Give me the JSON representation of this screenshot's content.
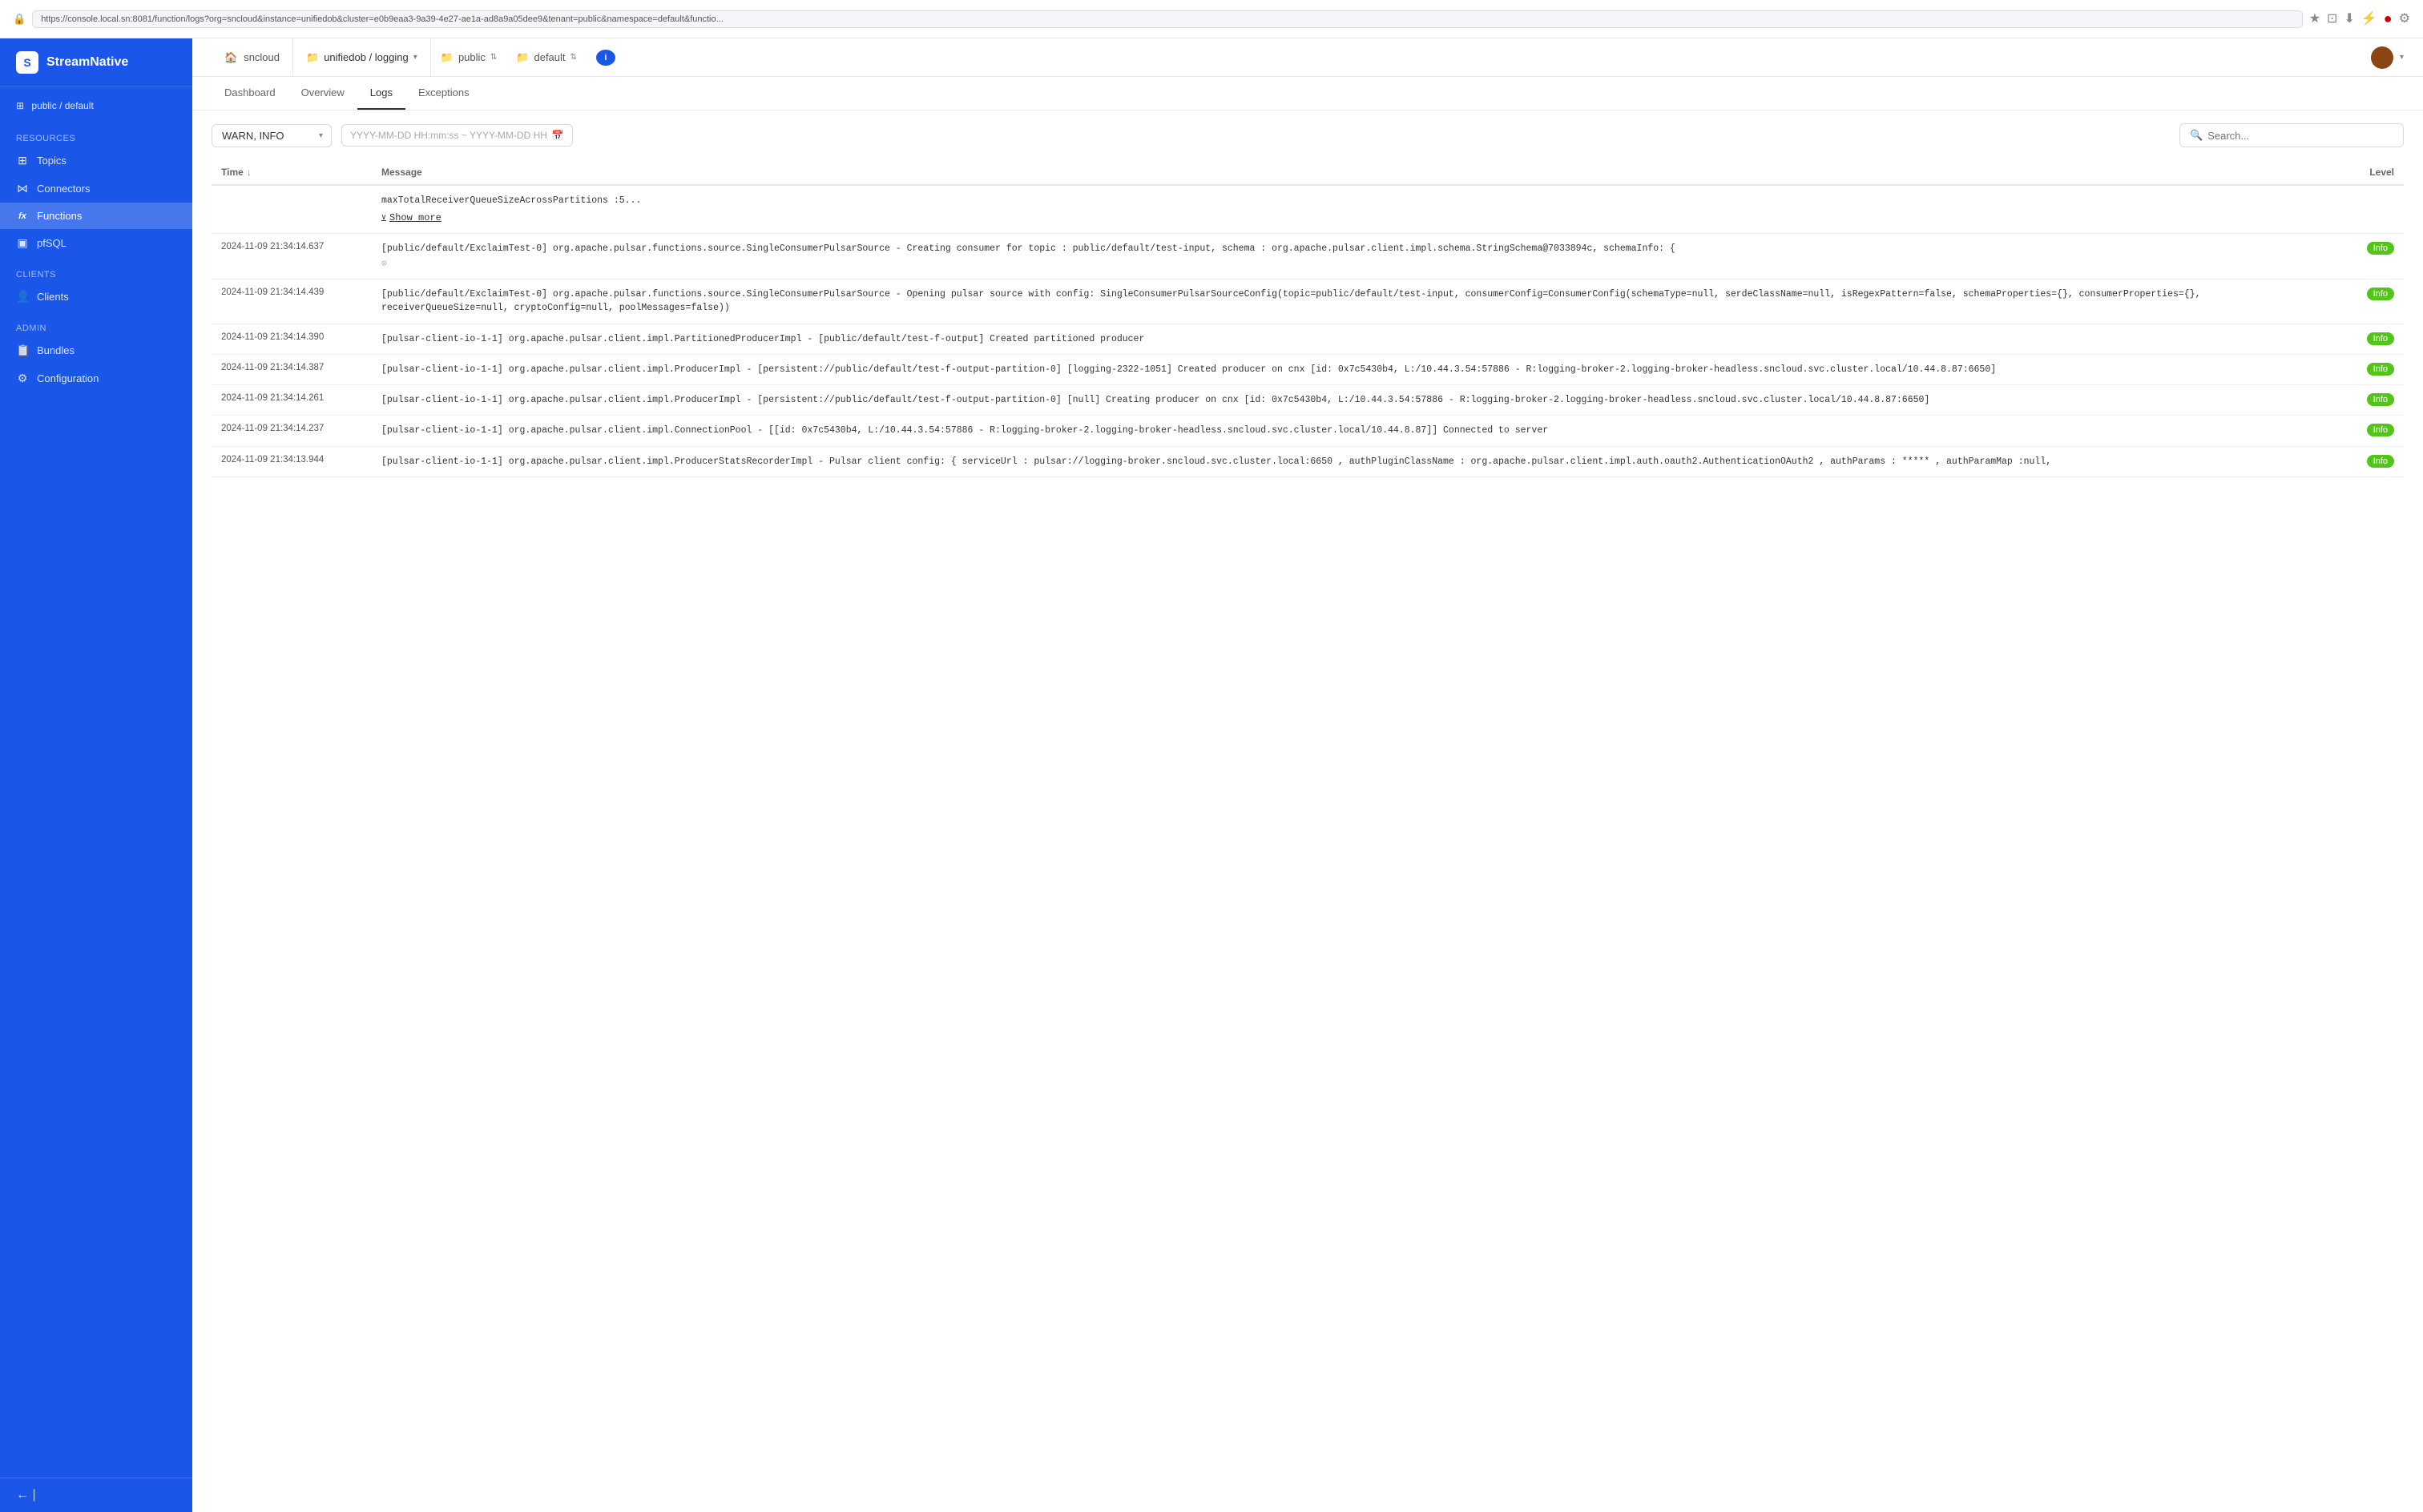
{
  "browser": {
    "url": "https://console.local.sn:8081/function/logs?org=sncloud&instance=unifiedob&cluster=e0b9eaa3-9a39-4e27-ae1a-ad8a9a05dee9&tenant=public&namespace=default&functio..."
  },
  "sidebar": {
    "brand": "StreamNative",
    "namespace": "public / default",
    "resources_label": "Resources",
    "items": [
      {
        "id": "topics",
        "label": "Topics",
        "icon": "⊞"
      },
      {
        "id": "connectors",
        "label": "Connectors",
        "icon": "⋈"
      },
      {
        "id": "functions",
        "label": "Functions",
        "icon": "fx",
        "active": true
      },
      {
        "id": "pfsql",
        "label": "pfSQL",
        "icon": "▣"
      }
    ],
    "clients_label": "Clients",
    "client_items": [
      {
        "id": "clients",
        "label": "Clients",
        "icon": "👤"
      }
    ],
    "admin_label": "Admin",
    "admin_items": [
      {
        "id": "bundles",
        "label": "Bundles",
        "icon": "📦"
      },
      {
        "id": "configuration",
        "label": "Configuration",
        "icon": "⚙"
      }
    ],
    "collapse_label": "Collapse"
  },
  "nav": {
    "org": "sncloud",
    "instance": "unifiedob / logging",
    "namespace1": "public",
    "namespace2": "default",
    "info_label": "i"
  },
  "tabs": [
    {
      "id": "dashboard",
      "label": "Dashboard"
    },
    {
      "id": "overview",
      "label": "Overview"
    },
    {
      "id": "logs",
      "label": "Logs",
      "active": true
    },
    {
      "id": "exceptions",
      "label": "Exceptions"
    }
  ],
  "controls": {
    "filter_value": "WARN, INFO",
    "date_placeholder": "YYYY-MM-DD HH:mm:ss ~ YYYY-MM-DD HH",
    "search_placeholder": "Search..."
  },
  "table": {
    "columns": [
      {
        "id": "time",
        "label": "Time"
      },
      {
        "id": "message",
        "label": "Message"
      },
      {
        "id": "level",
        "label": "Level"
      }
    ],
    "rows": [
      {
        "id": "row-showmore",
        "time": "",
        "message_prefix": "maxTotalReceiverQueueSizeAcrossPartitions :5...",
        "show_more": "Show more",
        "level": "",
        "has_badge": false
      },
      {
        "id": "row-1",
        "time": "2024-11-09 21:34:14.637",
        "message": "[public/default/ExclaimTest-0] org.apache.pulsar.functions.source.SingleConsumerPulsarSource - Creating consumer for topic : public/default/test-input, schema : org.apache.pulsar.client.impl.schema.StringSchema@7033894c, schemaInfo: {",
        "level": "Info",
        "has_badge": true,
        "has_copy": true
      },
      {
        "id": "row-2",
        "time": "2024-11-09 21:34:14.439",
        "message": "[public/default/ExclaimTest-0] org.apache.pulsar.functions.source.SingleConsumerPulsarSource - Opening pulsar source with config: SingleConsumerPulsarSourceConfig(topic=public/default/test-input, consumerConfig=ConsumerConfig(schemaType=null, serdeClassName=null, isRegexPattern=false, schemaProperties={}, consumerProperties={}, receiverQueueSize=null, cryptoConfig=null, poolMessages=false))",
        "level": "Info",
        "has_badge": true
      },
      {
        "id": "row-3",
        "time": "2024-11-09 21:34:14.390",
        "message": "[pulsar-client-io-1-1] org.apache.pulsar.client.impl.PartitionedProducerImpl - [public/default/test-f-output] Created partitioned producer",
        "level": "Info",
        "has_badge": true
      },
      {
        "id": "row-4",
        "time": "2024-11-09 21:34:14.387",
        "message": "[pulsar-client-io-1-1] org.apache.pulsar.client.impl.ProducerImpl - [persistent://public/default/test-f-output-partition-0] [logging-2322-1051] Created producer on cnx [id: 0x7c5430b4, L:/10.44.3.54:57886 - R:logging-broker-2.logging-broker-headless.sncloud.svc.cluster.local/10.44.8.87:6650]",
        "level": "Info",
        "has_badge": true
      },
      {
        "id": "row-5",
        "time": "2024-11-09 21:34:14.261",
        "message": "[pulsar-client-io-1-1] org.apache.pulsar.client.impl.ProducerImpl - [persistent://public/default/test-f-output-partition-0] [null] Creating producer on cnx [id: 0x7c5430b4, L:/10.44.3.54:57886 - R:logging-broker-2.logging-broker-headless.sncloud.svc.cluster.local/10.44.8.87:6650]",
        "level": "Info",
        "has_badge": true
      },
      {
        "id": "row-6",
        "time": "2024-11-09 21:34:14.237",
        "message": "[pulsar-client-io-1-1] org.apache.pulsar.client.impl.ConnectionPool - [[id: 0x7c5430b4, L:/10.44.3.54:57886 - R:logging-broker-2.logging-broker-headless.sncloud.svc.cluster.local/10.44.8.87]] Connected to server",
        "level": "Info",
        "has_badge": true
      },
      {
        "id": "row-7",
        "time": "2024-11-09 21:34:13.944",
        "message": "[pulsar-client-io-1-1] org.apache.pulsar.client.impl.ProducerStatsRecorderImpl - Pulsar client config: { serviceUrl : pulsar://logging-broker.sncloud.svc.cluster.local:6650 , authPluginClassName : org.apache.pulsar.client.impl.auth.oauth2.AuthenticationOAuth2 , authParams : ***** , authParamMap :null,",
        "level": "Info",
        "has_badge": true
      }
    ]
  }
}
